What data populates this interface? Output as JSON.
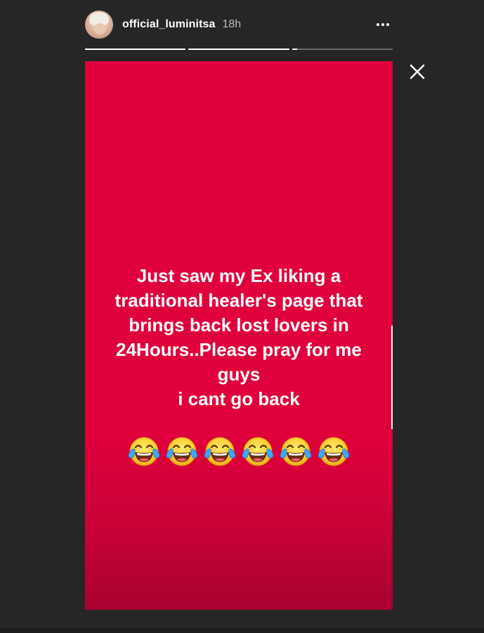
{
  "header": {
    "username": "official_luminitsa",
    "time": "18h",
    "avatar_icon": "profile-avatar",
    "more_icon": "more-horizontal-icon"
  },
  "progress": {
    "segments": [
      1.0,
      1.0,
      0.05
    ]
  },
  "close_icon": "close-icon",
  "story": {
    "background_color": "#e0003c",
    "lines": [
      "Just saw my Ex liking a",
      "traditional healer's page that",
      "brings back lost lovers in",
      "24Hours..Please pray for me",
      "guys",
      "i cant go back"
    ],
    "emoji_count": 6,
    "emoji_name": "face-with-tears-of-joy"
  }
}
